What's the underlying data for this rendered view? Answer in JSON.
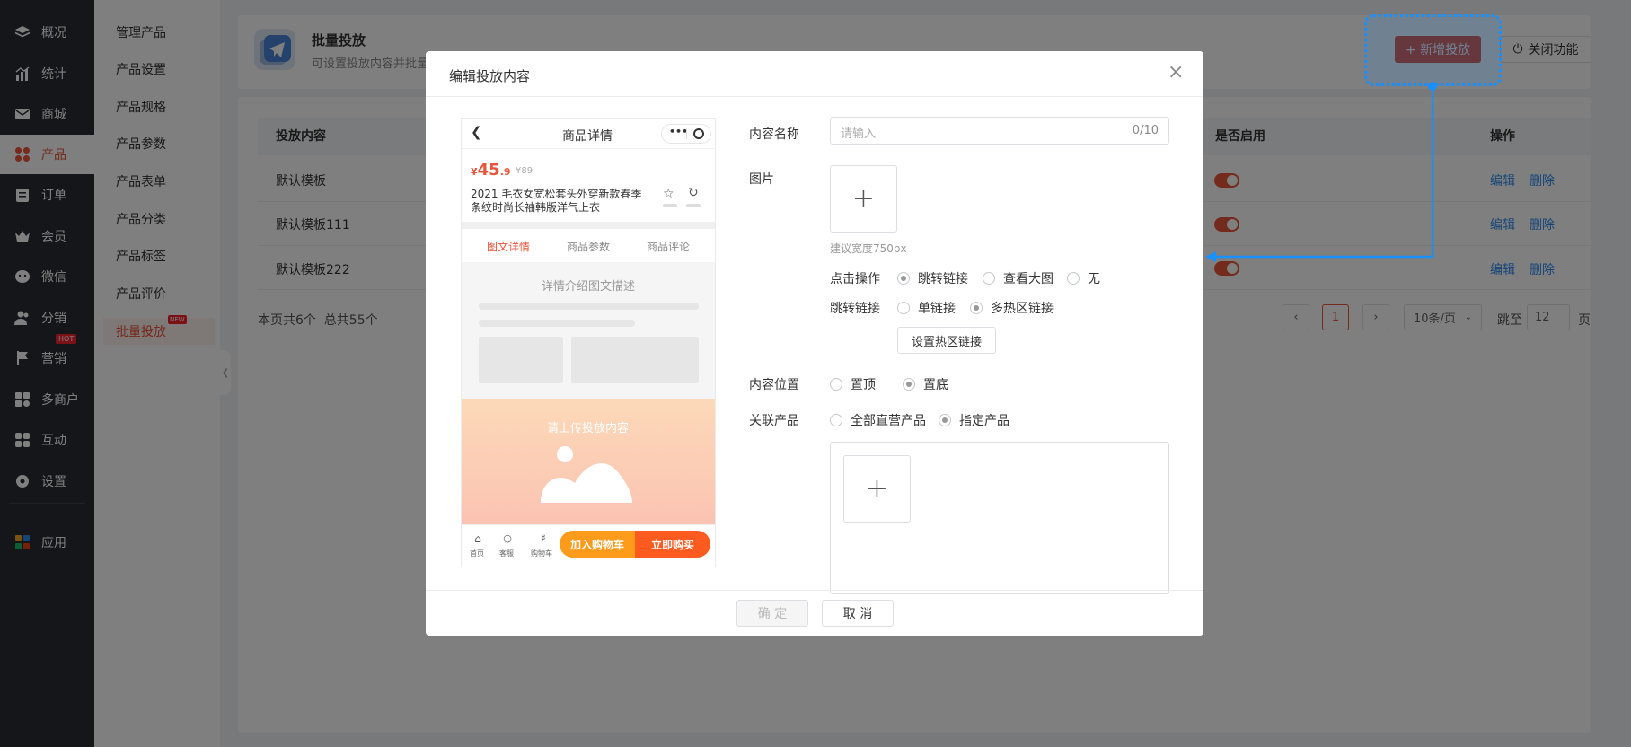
{
  "nav": {
    "items": [
      {
        "label": "概况",
        "icon": "layers-icon"
      },
      {
        "label": "统计",
        "icon": "chart-icon"
      },
      {
        "label": "商城",
        "icon": "mail-icon"
      },
      {
        "label": "产品",
        "icon": "grid-icon"
      },
      {
        "label": "订单",
        "icon": "clipboard-icon"
      },
      {
        "label": "会员",
        "icon": "crown-icon"
      },
      {
        "label": "微信",
        "icon": "wechat-icon"
      },
      {
        "label": "分销",
        "icon": "users-icon"
      },
      {
        "label": "营销",
        "icon": "flag-icon",
        "badge": "HOT"
      },
      {
        "label": "多商户",
        "icon": "store-icon"
      },
      {
        "label": "互动",
        "icon": "apps-icon"
      },
      {
        "label": "设置",
        "icon": "gear-icon"
      },
      {
        "label": "应用",
        "icon": "app-color-icon"
      }
    ]
  },
  "subnav": {
    "items": [
      "管理产品",
      "产品设置",
      "产品规格",
      "产品参数",
      "产品表单",
      "产品分类",
      "产品标签",
      "产品评价",
      "批量投放"
    ],
    "new_badge": "NEW"
  },
  "header": {
    "title": "批量投放",
    "desc": "可设置投放内容并批量",
    "add_button": "+ 新增投放",
    "close_button": "关闭功能"
  },
  "table": {
    "columns": {
      "content": "投放内容",
      "enabled": "是否启用",
      "actions": "操作"
    },
    "rows": [
      {
        "name": "默认模板",
        "edit": "编辑",
        "delete": "删除"
      },
      {
        "name": "默认模板111",
        "edit": "编辑",
        "delete": "删除"
      },
      {
        "name": "默认模板222",
        "edit": "编辑",
        "delete": "删除"
      }
    ],
    "summary": "本页共6个  总共55个"
  },
  "pagination": {
    "current": "1",
    "page_size": "10条/页",
    "jump_label": "跳至",
    "jump_value": "12",
    "page_unit": "页"
  },
  "modal": {
    "title": "编辑投放内容",
    "phone": {
      "title": "商品详情",
      "currency": "¥",
      "price_int": "45",
      "price_dec": ".9",
      "old_price": "¥89",
      "product_line1": "2021 毛衣女宽松套头外穿新款春季",
      "product_line2": "条纹时尚长袖韩版洋气上衣",
      "tabs": [
        "图文详情",
        "商品参数",
        "商品评论"
      ],
      "detail_placeholder": "详情介绍图文描述",
      "upload_hint": "请上传投放内容",
      "bottom_icons": [
        "首页",
        "客服",
        "购物车"
      ],
      "cart_button": "加入购物车",
      "buy_button": "立即购买"
    },
    "form": {
      "name_label": "内容名称",
      "name_placeholder": "请输入",
      "name_count": "0/10",
      "image_label": "图片",
      "image_hint": "建议宽度750px",
      "click_label": "点击操作",
      "click_options": [
        "跳转链接",
        "查看大图",
        "无"
      ],
      "link_label": "跳转链接",
      "link_options": [
        "单链接",
        "多热区链接"
      ],
      "hotzone_button": "设置热区链接",
      "position_label": "内容位置",
      "position_options": [
        "置顶",
        "置底"
      ],
      "product_label": "关联产品",
      "product_options": [
        "全部直营产品",
        "指定产品"
      ]
    },
    "confirm": "确 定",
    "cancel": "取 消"
  },
  "colors": {
    "accent": "#e8553a",
    "link": "#2d8cf0",
    "annotation": "#1890ff",
    "sidebar": "#282c34"
  }
}
